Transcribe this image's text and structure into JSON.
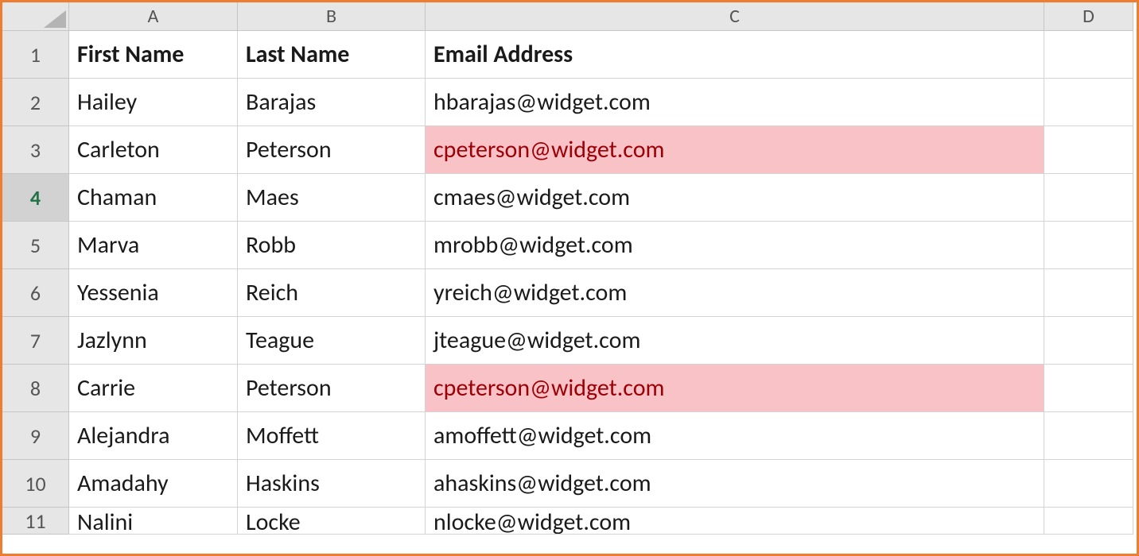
{
  "columns": [
    "A",
    "B",
    "C",
    "D"
  ],
  "headers": {
    "a": "First Name",
    "b": "Last Name",
    "c": "Email Address"
  },
  "active_row": 4,
  "rows": [
    {
      "n": 2,
      "first": "Hailey",
      "last": "Barajas",
      "email": "hbarajas@widget.com",
      "dup": false
    },
    {
      "n": 3,
      "first": "Carleton",
      "last": "Peterson",
      "email": "cpeterson@widget.com",
      "dup": true
    },
    {
      "n": 4,
      "first": "Chaman",
      "last": "Maes",
      "email": "cmaes@widget.com",
      "dup": false
    },
    {
      "n": 5,
      "first": "Marva",
      "last": "Robb",
      "email": "mrobb@widget.com",
      "dup": false
    },
    {
      "n": 6,
      "first": "Yessenia",
      "last": "Reich",
      "email": "yreich@widget.com",
      "dup": false
    },
    {
      "n": 7,
      "first": "Jazlynn",
      "last": "Teague",
      "email": "jteague@widget.com",
      "dup": false
    },
    {
      "n": 8,
      "first": "Carrie",
      "last": "Peterson",
      "email": "cpeterson@widget.com",
      "dup": true
    },
    {
      "n": 9,
      "first": "Alejandra",
      "last": "Moffett",
      "email": "amoffett@widget.com",
      "dup": false
    },
    {
      "n": 10,
      "first": "Amadahy",
      "last": "Haskins",
      "email": "ahaskins@widget.com",
      "dup": false
    },
    {
      "n": 11,
      "first": "Nalini",
      "last": "Locke",
      "email": "nlocke@widget.com",
      "dup": false,
      "partial": true
    }
  ]
}
